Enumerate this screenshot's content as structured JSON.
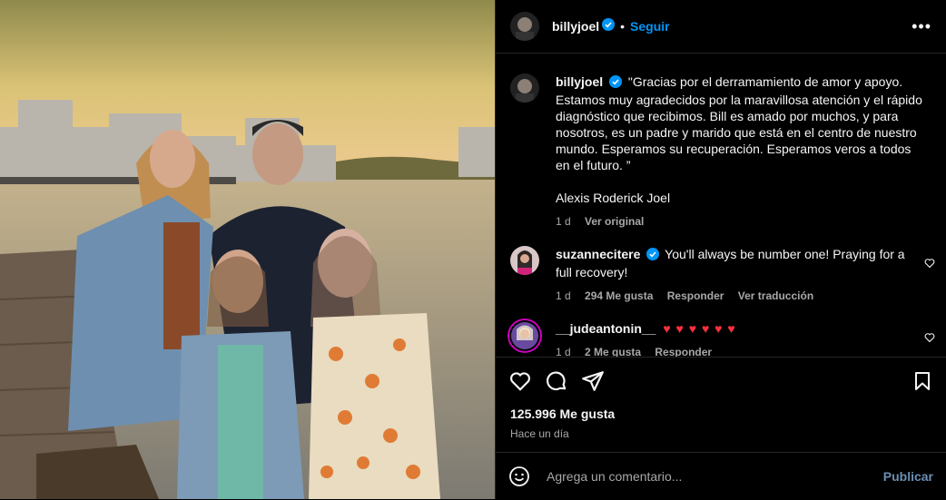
{
  "post": {
    "author": "billyjoel",
    "follow_label": "Seguir",
    "dot": "•",
    "more_label": "•••"
  },
  "caption": {
    "author": "billyjoel",
    "text": "\"Gracias por el derramamiento de amor y apoyo. Estamos muy agradecidos por la maravillosa atención y el rápido diagnóstico que recibimos. Bill es amado por muchos, y para nosotros, es un padre y marido que está en el centro de nuestro mundo. Esperamos su recuperación. Esperamos veros a todos en el futuro. ”",
    "signature": "Alexis Roderick Joel",
    "time": "1 d",
    "see_original": "Ver original"
  },
  "comments": [
    {
      "author": "suzannecitere",
      "text": "You'll always be number one! Praying for a full recovery!",
      "time": "1 d",
      "likes": "294 Me gusta",
      "reply": "Responder",
      "translate": "Ver traducción"
    },
    {
      "author": "__judeantonin__",
      "text": "♥ ♥ ♥ ♥ ♥ ♥",
      "time": "1 d",
      "likes": "2 Me gusta",
      "reply": "Responder"
    }
  ],
  "stats": {
    "likes": "125.996 Me gusta",
    "time": "Hace un día"
  },
  "composer": {
    "placeholder": "Agrega un comentario...",
    "publish_label": "Publicar"
  },
  "icons": [
    "verified-icon",
    "more-icon",
    "heart-icon",
    "comment-icon",
    "share-icon",
    "bookmark-icon",
    "emoji-icon"
  ],
  "colors": {
    "accent": "#0095f6",
    "like": "#ff3040",
    "background": "#000000"
  }
}
